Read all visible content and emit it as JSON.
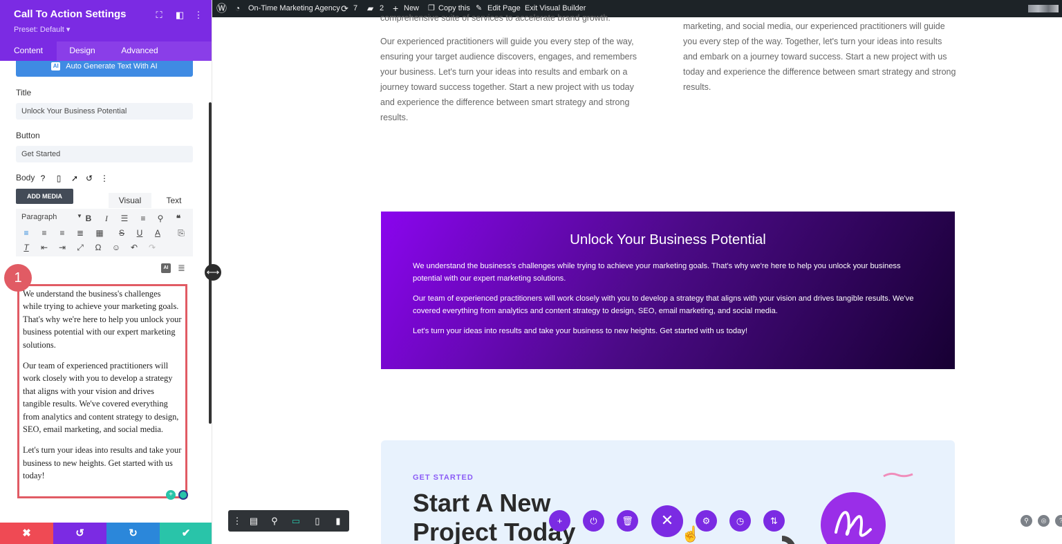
{
  "panel": {
    "title": "Call To Action Settings",
    "preset": "Preset: Default ▾",
    "tabs": [
      "Content",
      "Design",
      "Advanced"
    ],
    "ai_button_badge": "AI",
    "ai_button": "Auto Generate Text With AI",
    "title_label": "Title",
    "title_value": "Unlock Your Business Potential",
    "button_label": "Button",
    "button_value": "Get Started",
    "body_label": "Body",
    "add_media": "ADD MEDIA",
    "editor_tabs": [
      "Visual",
      "Text"
    ],
    "paragraph_select": "Paragraph",
    "editor_ai_badge": "AI",
    "step_badge": "1",
    "body_paragraphs": [
      "We understand the business's challenges while trying to achieve your marketing goals. That's why we're here to help you unlock your business potential with our expert marketing solutions.",
      "Our team of experienced practitioners will work closely with you to develop a strategy that aligns with your vision and drives tangible results. We've covered everything from analytics and content strategy to design, SEO, email marketing, and social media.",
      "Let's turn your ideas into results and take your business to new heights. Get started with us today!"
    ]
  },
  "adminbar": {
    "site_name": "On-Time Marketing Agency",
    "updates": "7",
    "comments": "2",
    "new": "New",
    "copy": "Copy this",
    "edit": "Edit Page",
    "exit": "Exit Visual Builder"
  },
  "page": {
    "col1_top": "comprehensive suite of services to accelerate brand growth.",
    "col1_text": "Our experienced practitioners will guide you every step of the way, ensuring your target audience discovers, engages, and remembers your business. Let's turn your ideas into results and embark on a journey toward success together. Start a new project with us today and experience the difference between smart strategy and strong results.",
    "col2_text": "marketing, and social media, our experienced practitioners will guide you every step of the way. Together, let's turn your ideas into results and embark on a journey toward success. Start a new project with us today and experience the difference between smart strategy and strong results.",
    "cta": {
      "title": "Unlock Your Business Potential",
      "p1": "We understand the business's challenges while trying to achieve your marketing goals. That's why we're here to help you unlock your business potential with our expert marketing solutions.",
      "p2": "Our team of experienced practitioners will work closely with you to develop a strategy that aligns with your vision and drives tangible results. We've covered everything from analytics and content strategy to design, SEO, email marketing, and social media.",
      "p3": "Let's turn your ideas into results and take your business to new heights. Get started with us today!"
    },
    "card": {
      "eyebrow": "GET STARTED",
      "title": "Start A New Project Today"
    }
  },
  "colors": {
    "accent": "#7b2be3",
    "blue": "#3f8be3",
    "highlight": "#e15b64",
    "cancel": "#ef4a54",
    "redo": "#2b87da",
    "save": "#29c4a9"
  },
  "icons": {
    "panel_header": [
      "expand-icon",
      "sidebar-icon",
      "more-icon"
    ],
    "adminbar": [
      "wordpress-icon",
      "dashboard-icon",
      "refresh-icon",
      "comment-icon",
      "plus-icon",
      "copy-icon",
      "pencil-icon"
    ],
    "body_tools": [
      "help-icon",
      "mobile-icon",
      "cursor-icon",
      "undo-icon",
      "more-icon"
    ],
    "footer": [
      "close-icon",
      "undo-icon",
      "redo-icon",
      "check-icon"
    ]
  }
}
